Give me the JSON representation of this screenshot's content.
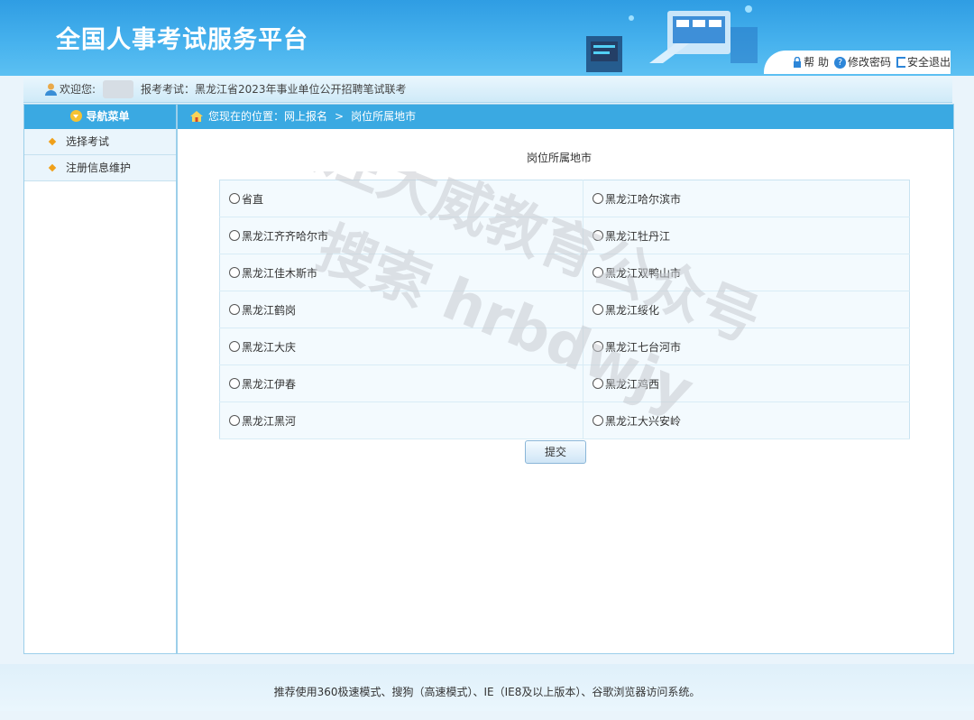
{
  "header": {
    "title": "全国人事考试服务平台",
    "links": [
      {
        "icon": "lock-icon",
        "label": "帮 助"
      },
      {
        "icon": "help-icon",
        "label": "修改密码"
      },
      {
        "icon": "exit-icon",
        "label": "安全退出"
      }
    ]
  },
  "welcome": {
    "greeting": "欢迎您:",
    "exam_text": "报考考试：黑龙江省2023年事业单位公开招聘笔试联考"
  },
  "sidebar": {
    "title": "导航菜单",
    "items": [
      "选择考试",
      "注册信息维护"
    ]
  },
  "breadcrumb": {
    "prefix": "您现在的位置：",
    "path1": "网上报名",
    "separator": ">",
    "path2": "岗位所属地市"
  },
  "form": {
    "title": "岗位所属地市",
    "options": [
      [
        "省直",
        "黑龙江哈尔滨市"
      ],
      [
        "黑龙江齐齐哈尔市",
        "黑龙江牡丹江"
      ],
      [
        "黑龙江佳木斯市",
        "黑龙江双鸭山市"
      ],
      [
        "黑龙江鹤岗",
        "黑龙江绥化"
      ],
      [
        "黑龙江大庆",
        "黑龙江七台河市"
      ],
      [
        "黑龙江伊春",
        "黑龙江鸡西"
      ],
      [
        "黑龙江黑河",
        "黑龙江大兴安岭"
      ]
    ],
    "submit_label": "提交"
  },
  "watermark": {
    "line1": "关注大威教育公众号",
    "line2": "搜索 hrbdwjy"
  },
  "footer": {
    "text": "推荐使用360极速模式、搜狗（高速模式）、IE（IE8及以上版本）、谷歌浏览器访问系统。"
  }
}
